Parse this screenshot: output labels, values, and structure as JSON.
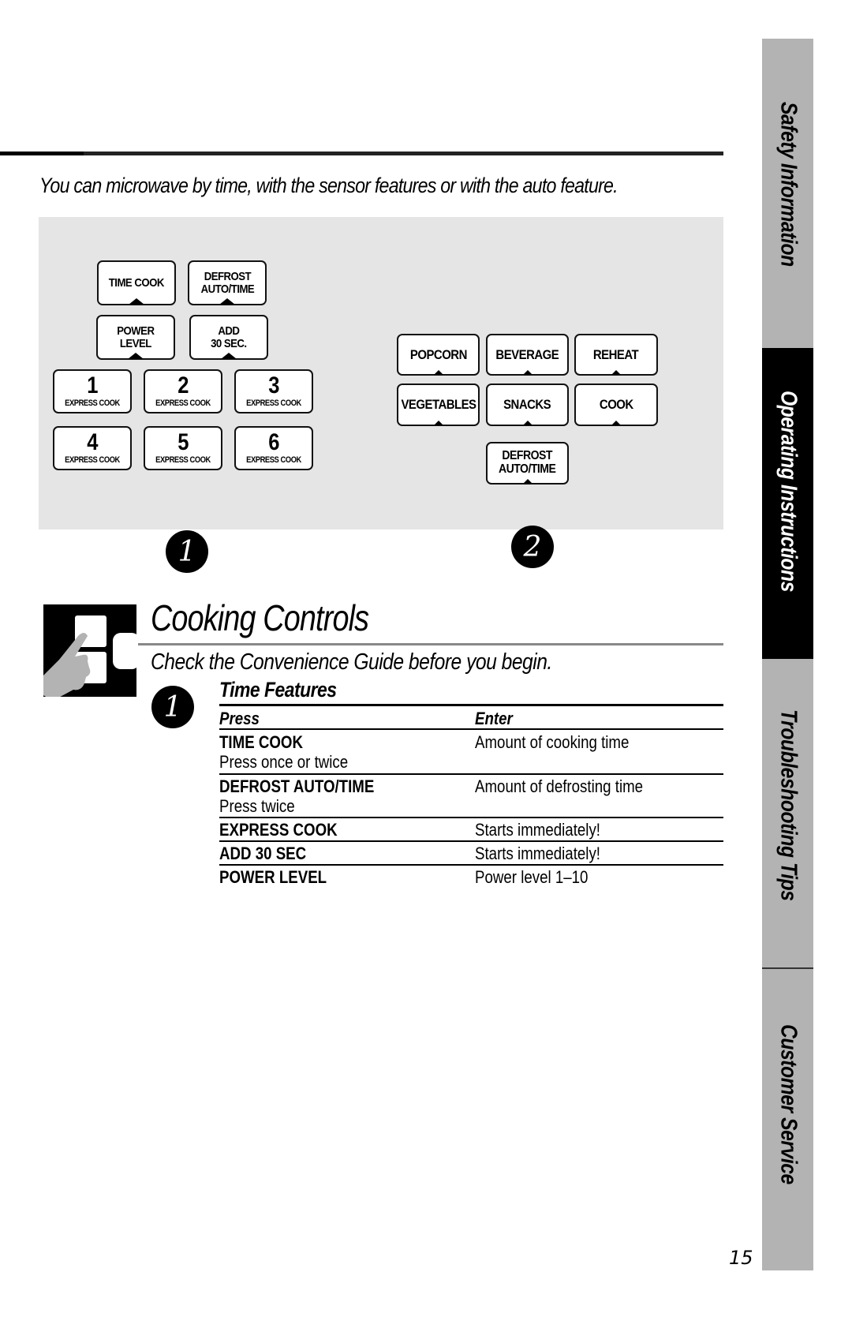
{
  "intro_text": "You can microwave by time, with the sensor features or with the auto feature.",
  "panel_left": {
    "keys": [
      {
        "label": "TIME COOK"
      },
      {
        "label": "DEFROST\nAUTO/TIME"
      },
      {
        "label": "POWER\nLEVEL"
      },
      {
        "label": "ADD\n30 SEC."
      }
    ],
    "express_keys": [
      {
        "number": "1",
        "sub": "EXPRESS COOK"
      },
      {
        "number": "2",
        "sub": "EXPRESS COOK"
      },
      {
        "number": "3",
        "sub": "EXPRESS COOK"
      },
      {
        "number": "4",
        "sub": "EXPRESS COOK"
      },
      {
        "number": "5",
        "sub": "EXPRESS COOK"
      },
      {
        "number": "6",
        "sub": "EXPRESS COOK"
      }
    ]
  },
  "panel_right": {
    "keys": [
      {
        "label": "POPCORN"
      },
      {
        "label": "BEVERAGE"
      },
      {
        "label": "REHEAT"
      },
      {
        "label": "VEGETABLES"
      },
      {
        "label": "SNACKS"
      },
      {
        "label": "COOK"
      },
      {
        "label": "DEFROST\nAUTO/TIME"
      }
    ]
  },
  "callouts": {
    "one": "1",
    "two": "2"
  },
  "heading": {
    "icon": "finger-pressing-keypad-icon",
    "title": "Cooking Controls",
    "subtitle": "Check the Convenience Guide before you begin."
  },
  "section": {
    "number": "1",
    "title": "Time Features",
    "columns": [
      "Press",
      "Enter"
    ],
    "rows": [
      {
        "press": "TIME COOK",
        "note": "Press once or twice",
        "enter": "Amount of cooking time"
      },
      {
        "press": "DEFROST AUTO/TIME",
        "note": "Press twice",
        "enter": "Amount of defrosting time"
      },
      {
        "press": "EXPRESS COOK",
        "note": "",
        "enter": "Starts immediately!"
      },
      {
        "press": "ADD 30 SEC",
        "note": "",
        "enter": "Starts immediately!"
      },
      {
        "press": "POWER LEVEL",
        "note": "",
        "enter": "Power level 1–10"
      }
    ]
  },
  "sidebar": {
    "tabs": [
      {
        "label": "Safety Information",
        "active": false
      },
      {
        "label": "Operating Instructions",
        "active": true
      },
      {
        "label": "Troubleshooting Tips",
        "active": false
      },
      {
        "label": "Customer Service",
        "active": false
      }
    ]
  },
  "page_number": "15"
}
